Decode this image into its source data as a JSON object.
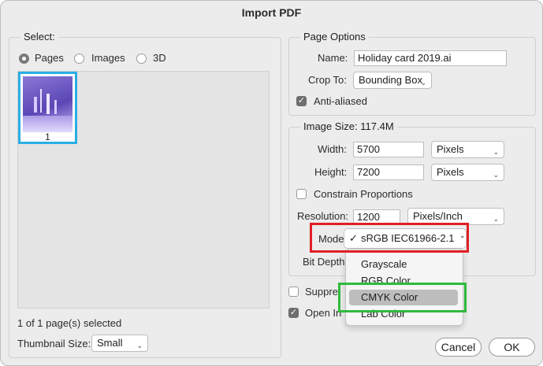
{
  "window": {
    "title": "Import PDF"
  },
  "select": {
    "title": "Select:",
    "options": [
      "Pages",
      "Images",
      "3D"
    ],
    "selected": "Pages",
    "thumb_label": "1",
    "status": "1 of 1 page(s) selected",
    "thumb_size_label": "Thumbnail Size:",
    "thumb_size_value": "Small"
  },
  "page_options": {
    "title": "Page Options",
    "name_label": "Name:",
    "name_value": "Holiday card 2019.ai",
    "crop_label": "Crop To:",
    "crop_value": "Bounding Box",
    "anti_aliased_label": "Anti-aliased",
    "anti_aliased": true
  },
  "image_size": {
    "title": "Image Size: 117.4M",
    "width_label": "Width:",
    "width_value": "5700",
    "width_unit": "Pixels",
    "height_label": "Height:",
    "height_value": "7200",
    "height_unit": "Pixels",
    "constrain_label": "Constrain Proportions",
    "constrain": false,
    "resolution_label": "Resolution:",
    "resolution_value": "1200",
    "resolution_unit": "Pixels/Inch",
    "mode_label": "Mode",
    "bit_depth_label": "Bit Depth"
  },
  "mode_menu": {
    "selected": "sRGB IEC61966-2.1",
    "checkmark": "✓",
    "items": [
      "Grayscale",
      "RGB Color",
      "CMYK Color",
      "Lab Color"
    ],
    "highlighted": "CMYK Color"
  },
  "bottom_options": {
    "suppress_label": "Suppre",
    "open_label": "Open In"
  },
  "buttons": {
    "cancel": "Cancel",
    "ok": "OK"
  },
  "colors": {
    "thumb_border": "#29aee6",
    "red_annotation": "#e21e26",
    "green_annotation": "#2fba3c"
  }
}
